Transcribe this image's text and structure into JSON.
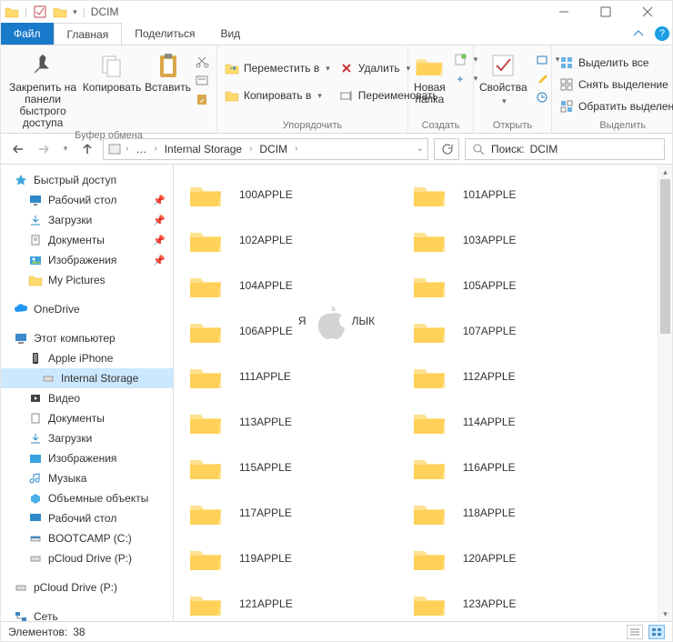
{
  "titlebar": {
    "title": "DCIM"
  },
  "ribbon_tabs": {
    "file": "Файл",
    "home": "Главная",
    "share": "Поделиться",
    "view": "Вид"
  },
  "ribbon": {
    "clipboard": {
      "pin": "Закрепить на панели быстрого доступа",
      "copy": "Копировать",
      "paste": "Вставить",
      "label": "Буфер обмена"
    },
    "organize": {
      "move_to": "Переместить в",
      "copy_to": "Копировать в",
      "delete": "Удалить",
      "rename": "Переименовать",
      "label": "Упорядочить"
    },
    "new": {
      "new_folder": "Новая папка",
      "label": "Создать"
    },
    "open": {
      "properties": "Свойства",
      "label": "Открыть"
    },
    "select": {
      "select_all": "Выделить все",
      "select_none": "Снять выделение",
      "invert": "Обратить выделение",
      "label": "Выделить"
    }
  },
  "nav": {
    "crumbs": [
      "Internal Storage",
      "DCIM"
    ],
    "search_prefix": "Поиск:",
    "search_target": "DCIM"
  },
  "tree": {
    "quick_access": "Быстрый доступ",
    "desktop": "Рабочий стол",
    "downloads": "Загрузки",
    "documents": "Документы",
    "pictures": "Изображения",
    "mypictures": "My Pictures",
    "onedrive": "OneDrive",
    "this_pc": "Этот компьютер",
    "iphone": "Apple iPhone",
    "internal": "Internal Storage",
    "video": "Видео",
    "documents2": "Документы",
    "downloads2": "Загрузки",
    "pictures2": "Изображения",
    "music": "Музыка",
    "objects3d": "Объемные объекты",
    "desktop2": "Рабочий стол",
    "bootcamp": "BOOTCAMP (C:)",
    "pcloud": "pCloud Drive (P:)",
    "pcloud2": "pCloud Drive (P:)",
    "network": "Сеть"
  },
  "folders_left": [
    "100APPLE",
    "102APPLE",
    "104APPLE",
    "106APPLE",
    "111APPLE",
    "113APPLE",
    "115APPLE",
    "117APPLE",
    "119APPLE",
    "121APPLE"
  ],
  "folders_right": [
    "101APPLE",
    "103APPLE",
    "105APPLE",
    "107APPLE",
    "112APPLE",
    "114APPLE",
    "116APPLE",
    "118APPLE",
    "120APPLE",
    "123APPLE"
  ],
  "status": {
    "items_label": "Элементов:",
    "items_count": "38"
  },
  "watermark": {
    "left": "Я",
    "right": "ЛЫК"
  }
}
